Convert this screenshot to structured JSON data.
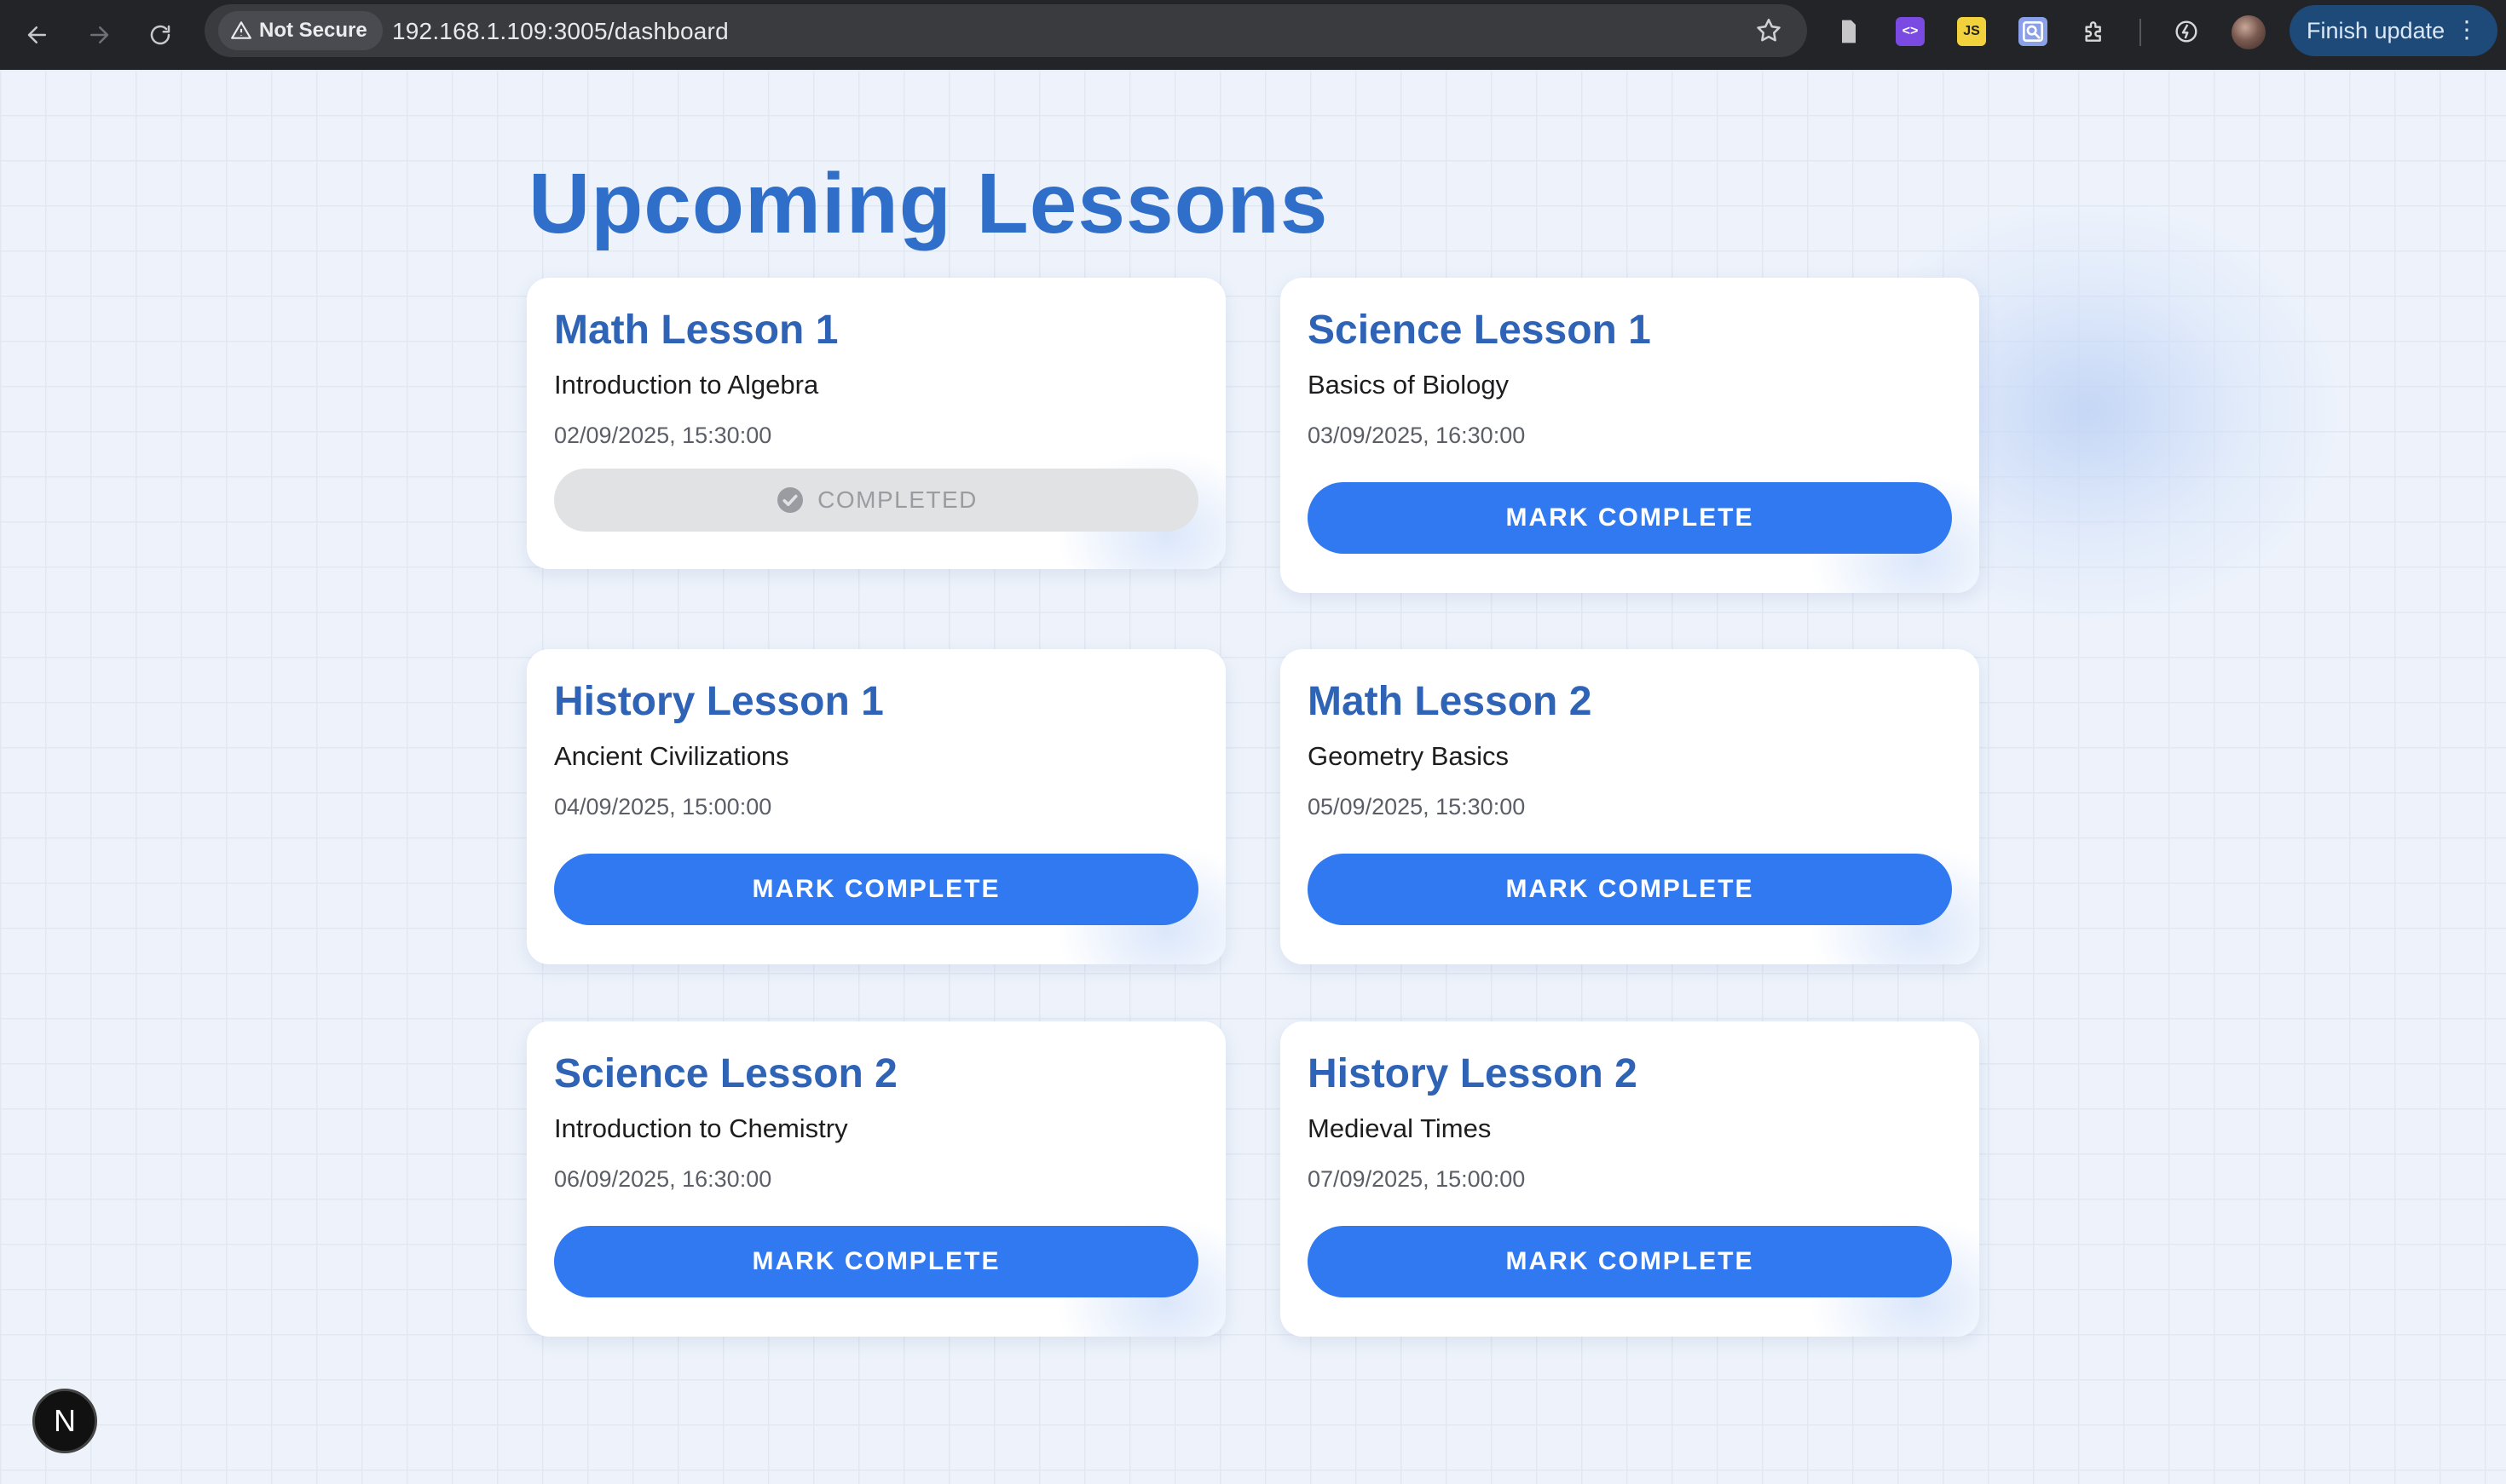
{
  "browser": {
    "security_label": "Not Secure",
    "url": "192.168.1.109:3005/dashboard",
    "finish_update_label": "Finish update",
    "extensions": [
      "document-icon",
      "code-extension-icon",
      "js-extension-icon",
      "inspect-extension-icon",
      "puzzle-icon",
      "performance-icon"
    ]
  },
  "page": {
    "title": "Upcoming Lessons",
    "accent_color": "#3079f0",
    "title_color": "#2f6fca"
  },
  "lessons": [
    {
      "title": "Math Lesson 1",
      "description": "Introduction to Algebra",
      "datetime": "02/09/2025, 15:30:00",
      "status": "COMPLETED",
      "completed": true
    },
    {
      "title": "Science Lesson 1",
      "description": "Basics of Biology",
      "datetime": "03/09/2025, 16:30:00",
      "action": "MARK COMPLETE",
      "completed": false
    },
    {
      "title": "History Lesson 1",
      "description": "Ancient Civilizations",
      "datetime": "04/09/2025, 15:00:00",
      "action": "MARK COMPLETE",
      "completed": false
    },
    {
      "title": "Math Lesson 2",
      "description": "Geometry Basics",
      "datetime": "05/09/2025, 15:30:00",
      "action": "MARK COMPLETE",
      "completed": false
    },
    {
      "title": "Science Lesson 2",
      "description": "Introduction to Chemistry",
      "datetime": "06/09/2025, 16:30:00",
      "action": "MARK COMPLETE",
      "completed": false
    },
    {
      "title": "History Lesson 2",
      "description": "Medieval Times",
      "datetime": "07/09/2025, 15:00:00",
      "action": "MARK COMPLETE",
      "completed": false
    }
  ],
  "dev_badge": {
    "letter": "N"
  }
}
